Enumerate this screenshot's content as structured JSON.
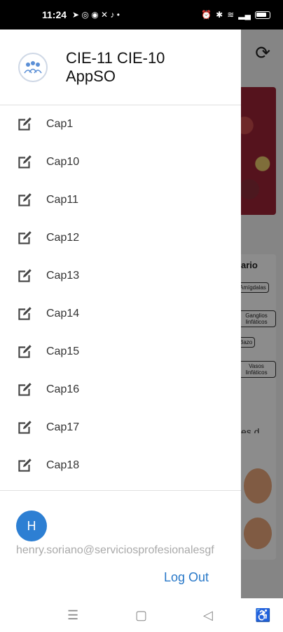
{
  "status_bar": {
    "time": "11:24"
  },
  "drawer": {
    "app_title_line1": "CIE-11 CIE-10",
    "app_title_line2": "AppSO",
    "items": [
      {
        "label": "Cap1"
      },
      {
        "label": "Cap10"
      },
      {
        "label": "Cap11"
      },
      {
        "label": "Cap12"
      },
      {
        "label": "Cap13"
      },
      {
        "label": "Cap14"
      },
      {
        "label": "Cap15"
      },
      {
        "label": "Cap16"
      },
      {
        "label": "Cap17"
      },
      {
        "label": "Cap18"
      }
    ],
    "user": {
      "avatar_initial": "H",
      "email": "henry.soriano@serviciosprofesionalesgf"
    },
    "logout_label": "Log Out"
  },
  "background": {
    "card_title": "ario",
    "chips": [
      "Amígdalas",
      "Ganglios linfáticos",
      "Bazo",
      "Vasos linfáticos"
    ],
    "card_text": "es d..."
  },
  "colors": {
    "accent": "#2878c8",
    "avatar_bg": "#2d7fd3"
  },
  "icons": {
    "menu_item_icon": "edit-icon"
  }
}
